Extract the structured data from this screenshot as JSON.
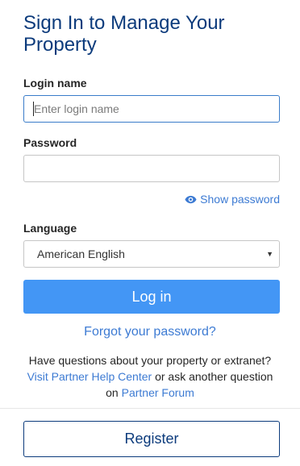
{
  "title": "Sign In to Manage Your Property",
  "login": {
    "label": "Login name",
    "placeholder": "Enter login name"
  },
  "password": {
    "label": "Password",
    "value": "",
    "show_label": "Show password",
    "show_icon": "eye-icon"
  },
  "language": {
    "label": "Language",
    "selected": "American English"
  },
  "actions": {
    "login_label": "Log in",
    "forgot_label": "Forgot your password?",
    "register_label": "Register"
  },
  "help": {
    "line1": "Have questions about your property or extranet?",
    "help_center_link": "Visit Partner Help Center",
    "middle": " or ask another question",
    "on": "on ",
    "forum_link": "Partner Forum"
  },
  "colors": {
    "title": "#0c3b7c",
    "link": "#3d7bd3",
    "primary_button": "#4396f5"
  }
}
